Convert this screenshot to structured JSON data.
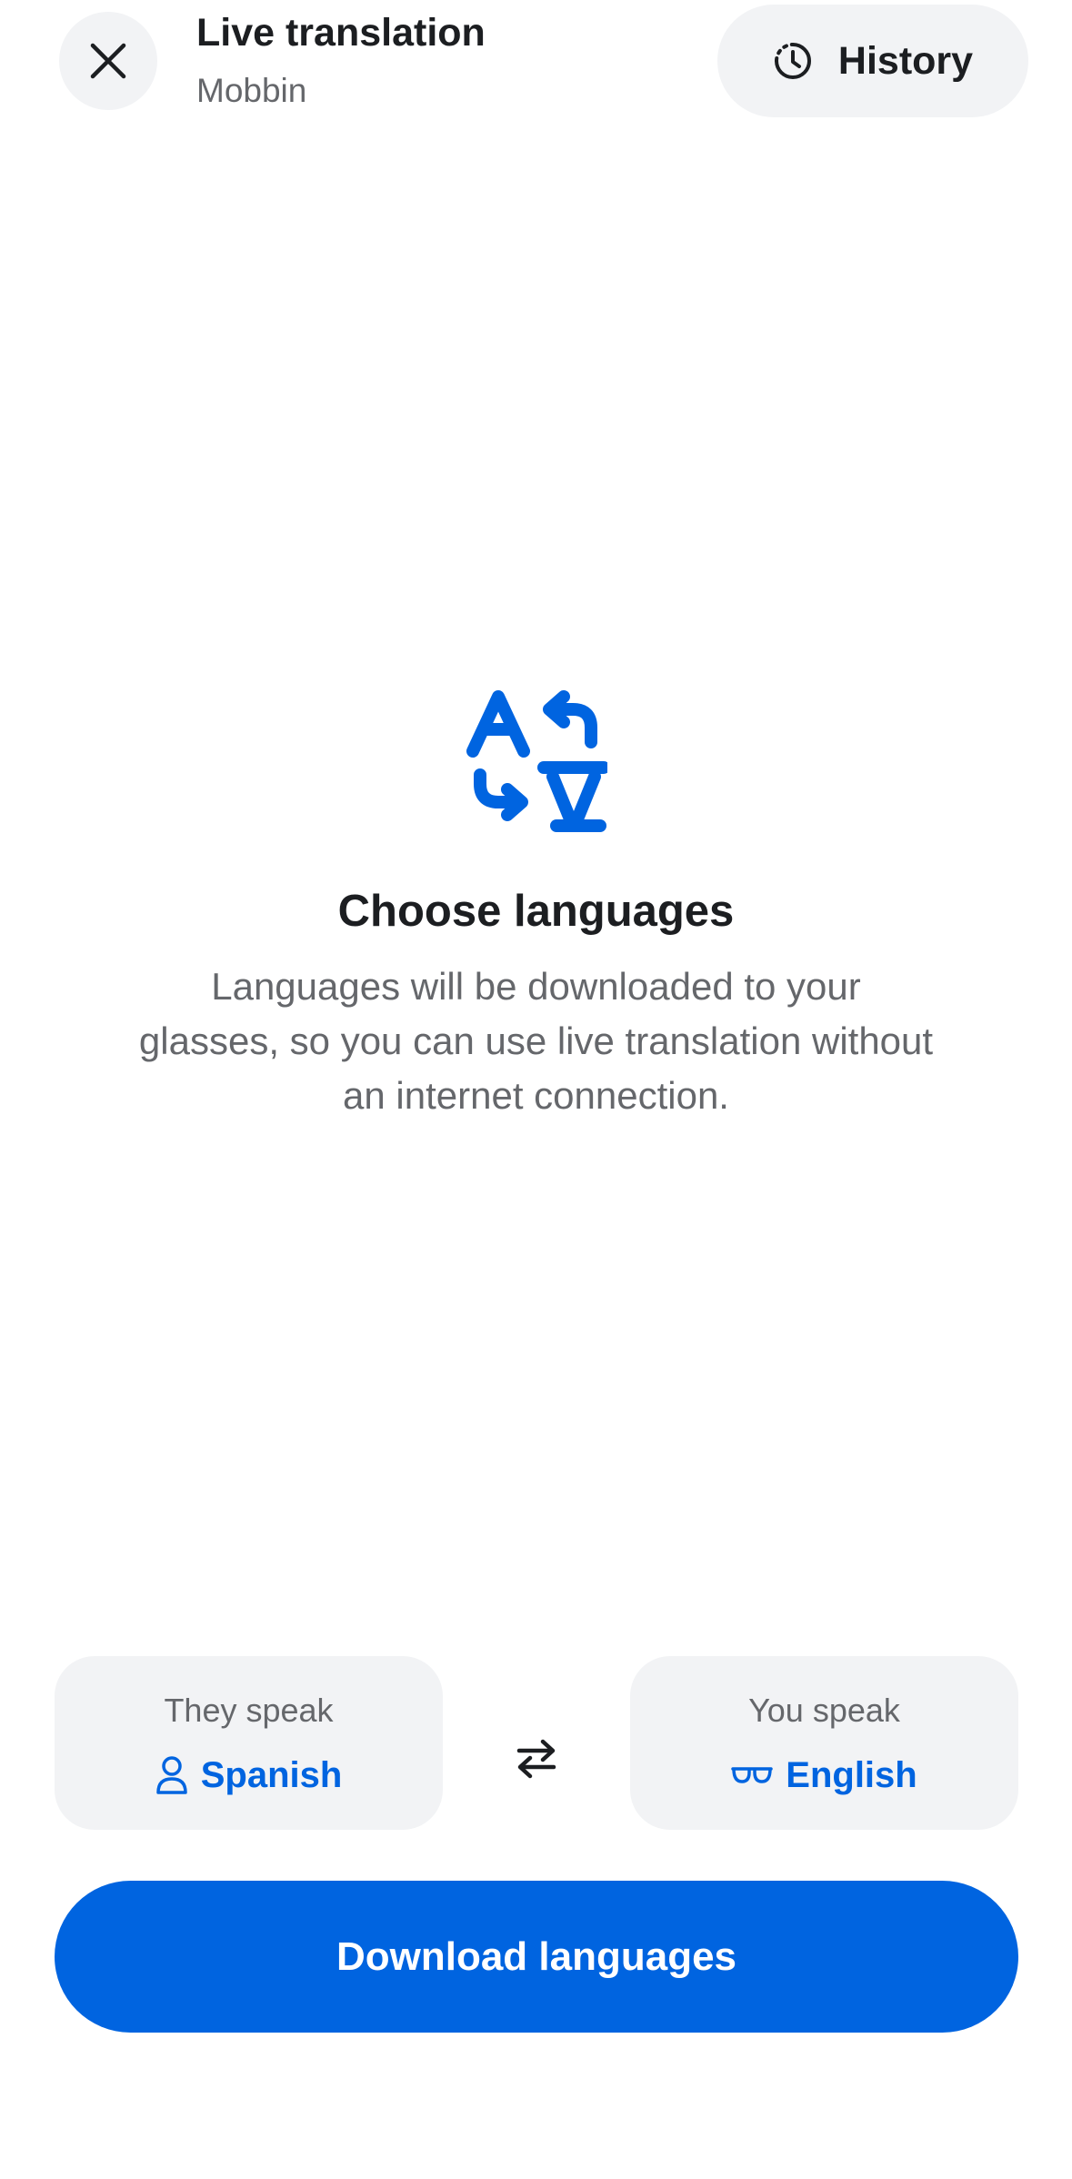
{
  "header": {
    "title": "Live translation",
    "subtitle": "Mobbin",
    "close_icon": "close-icon",
    "history_label": "History",
    "history_icon": "history-icon"
  },
  "main": {
    "icon": "translate-icon",
    "heading": "Choose languages",
    "description": "Languages will be downloaded to your glasses, so you can use live translation without an internet connection."
  },
  "languages": {
    "they": {
      "caption": "They speak",
      "icon": "person-icon",
      "value": "Spanish"
    },
    "you": {
      "caption": "You speak",
      "icon": "glasses-icon",
      "value": "English"
    },
    "swap_icon": "swap-icon"
  },
  "actions": {
    "download_label": "Download languages"
  },
  "colors": {
    "accent": "#0064e0",
    "surface": "#f2f3f5",
    "text_primary": "#1c1e21",
    "text_secondary": "#65676b"
  }
}
